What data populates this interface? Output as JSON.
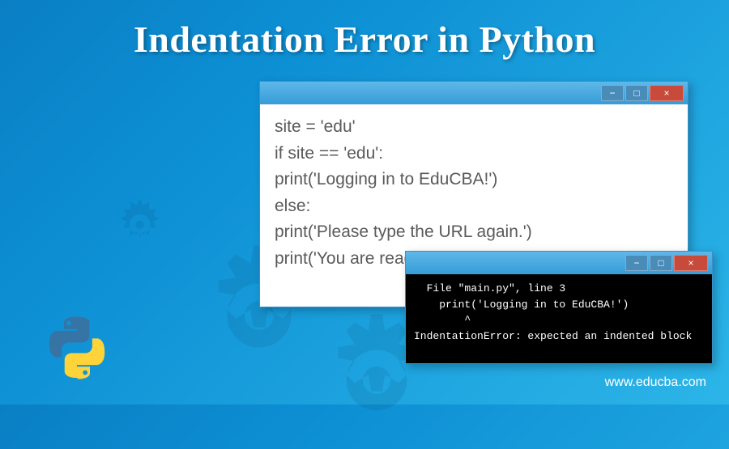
{
  "title": "Indentation Error in Python",
  "footer_url": "www.educba.com",
  "code_window": {
    "lines": [
      "site = 'edu'",
      "if site == 'edu':",
      "print('Logging in to EduCBA!')",
      "else:",
      "print('Please type the URL again.')",
      "print('You are ready to go!')"
    ]
  },
  "console_window": {
    "lines": [
      "  File \"main.py\", line 3",
      "    print('Logging in to EduCBA!')",
      "        ^",
      "IndentationError: expected an indented block"
    ]
  },
  "window_controls": {
    "minimize": "−",
    "maximize": "□",
    "close": "×"
  },
  "colors": {
    "bg_gradient_start": "#0a7fc4",
    "bg_gradient_end": "#2cb5e8",
    "titlebar": "#369bd8",
    "close_btn": "#c84a3a",
    "code_text": "#5a5a5a"
  }
}
